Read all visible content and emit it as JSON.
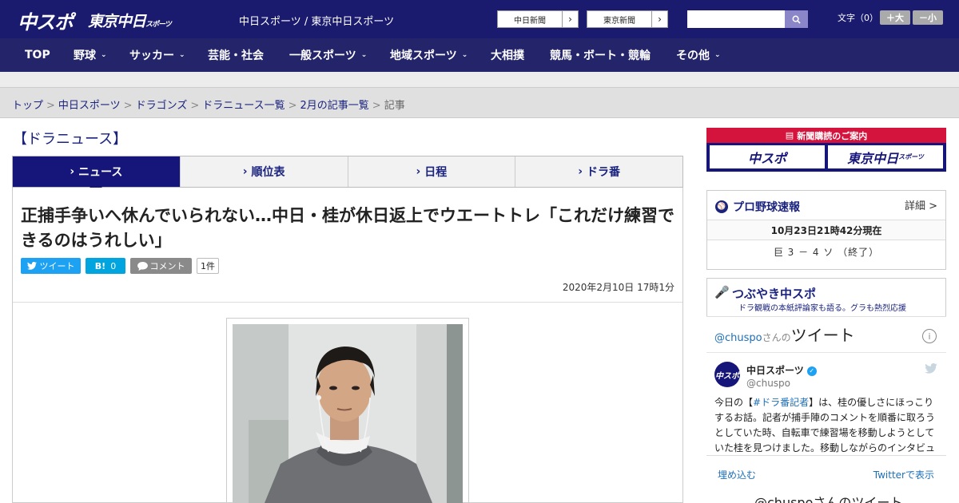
{
  "header": {
    "logo_chuspo": "中スポ",
    "logo_tokyo": "東京中日",
    "logo_tokyo_small": "スポーツ",
    "site_links": "中日スポーツ / 東京中日スポーツ",
    "ext_links": [
      {
        "label": "中日新聞"
      },
      {
        "label": "東京新聞"
      }
    ],
    "search": {
      "value": "",
      "placeholder": ""
    },
    "font_size_label": "文字（0）",
    "font_larger": "＋大",
    "font_smaller": "－小"
  },
  "nav": {
    "items": [
      {
        "label": "TOP",
        "chevron": ""
      },
      {
        "label": "野球",
        "chevron": "⌄"
      },
      {
        "label": "サッカー",
        "chevron": "⌄"
      },
      {
        "label": "芸能・社会",
        "chevron": ""
      },
      {
        "label": "一般スポーツ",
        "chevron": "⌄"
      },
      {
        "label": "地域スポーツ",
        "chevron": "⌄"
      },
      {
        "label": "大相撲",
        "chevron": ""
      },
      {
        "label": "競馬・ボート・競輪",
        "chevron": ""
      },
      {
        "label": "その他",
        "chevron": "⌄"
      }
    ]
  },
  "breadcrumb": {
    "items": [
      "トップ",
      "中日スポーツ",
      "ドラゴンズ",
      "ドラニュース一覧",
      "2月の記事一覧"
    ],
    "current": "記事",
    "separator": ">"
  },
  "section_title": "【ドラニュース】",
  "tabs": [
    {
      "label": "ニュース",
      "active": true
    },
    {
      "label": "順位表",
      "active": false
    },
    {
      "label": "日程",
      "active": false
    },
    {
      "label": "ドラ番",
      "active": false
    }
  ],
  "article": {
    "headline": "正捕手争いへ休んでいられない…中日・桂が休日返上でウエートトレ「これだけ練習できるのはうれしい」",
    "tweet_label": "ツイート",
    "hatena_label": "B!",
    "hatena_count": "0",
    "comment_label": "コメント",
    "comment_count": "1件",
    "date": "2020年2月10日 17時1分"
  },
  "sidebar": {
    "banner_title": "新聞購読のご案内",
    "banner_chuspo": "中スポ",
    "banner_tokyo": "東京中日",
    "banner_tokyo_small": "スポーツ",
    "baseball": {
      "heading": "プロ野球速報",
      "detail": "詳細 >",
      "time": "10月23日21時42分現在",
      "score": "巨 3 － 4 ソ （終了）"
    },
    "tsubuyaki": {
      "title": "つぶやき中スポ",
      "subtitle": "ドラ観戦の本紙評論家も語る。グラも熱烈応援"
    },
    "twitter": {
      "handle_header": "@chuspo",
      "sanno": "さんの",
      "tweet_word": "ツイート",
      "account_name": "中日スポーツ",
      "account_handle": "@chuspo",
      "text_before": "今日の【",
      "hashtag": "#ドラ番記者",
      "text_after": "】は、桂の優しさにほっこりするお話。記者が捕手陣のコメントを順番に取ろうとしていた時、自転車で練習場を移動しようとしていた桂を見つけました。移動しながらのインタビュ",
      "embed": "埋め込む",
      "view_on": "Twitterで表示",
      "bottom_text": "@chuspoさんのツイート"
    }
  },
  "colors": {
    "header_bg": "#1a1a6e",
    "nav_bg": "#24246b",
    "accent": "#15157a",
    "red": "#d4143c",
    "link": "#1d6fb8"
  }
}
